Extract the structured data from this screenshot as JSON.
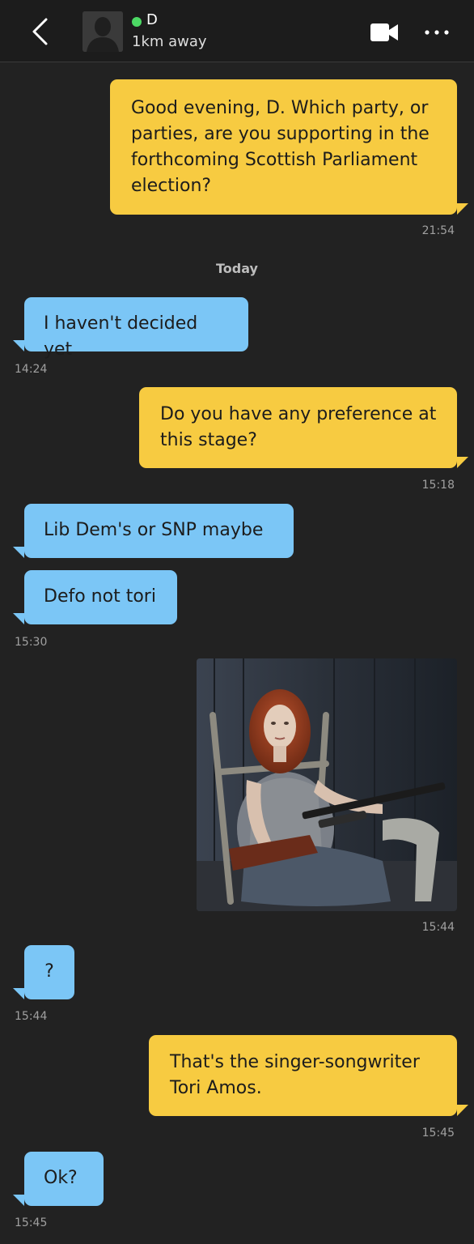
{
  "header": {
    "contact_name": "D",
    "distance": "1km away",
    "icons": {
      "back": "chevron-left-icon",
      "video": "video-camera-icon",
      "more": "more-dots-icon",
      "avatar": "person-silhouette-icon"
    },
    "online_color": "#4cd964"
  },
  "conversation": {
    "day_separator": "Today",
    "messages": [
      {
        "from": "me",
        "text": "Good evening, D. Which party, or parties, are you supporting in the forthcoming Scottish Parliament election?",
        "time": "21:54"
      },
      {
        "from": "them",
        "text": "I haven't decided yet",
        "time": "14:24"
      },
      {
        "from": "me",
        "text": "Do you have any preference at this stage?",
        "time": "15:18"
      },
      {
        "from": "them",
        "text": "Lib Dem's or SNP maybe"
      },
      {
        "from": "them",
        "text": "Defo not tori",
        "time": "15:30"
      },
      {
        "from": "me",
        "type": "image",
        "image": "photo of a red-haired woman seated on a wooden chair holding a rifle",
        "time": "15:44"
      },
      {
        "from": "them",
        "text": "?",
        "time": "15:44"
      },
      {
        "from": "me",
        "text": "That's the singer-songwriter Tori Amos.",
        "time": "15:45"
      },
      {
        "from": "them",
        "text": "Ok?",
        "time": "15:45"
      }
    ]
  },
  "colors": {
    "background": "#222222",
    "outgoing_bubble": "#f7cb41",
    "incoming_bubble": "#7bc6f6",
    "timestamp": "#a0a0a0"
  }
}
